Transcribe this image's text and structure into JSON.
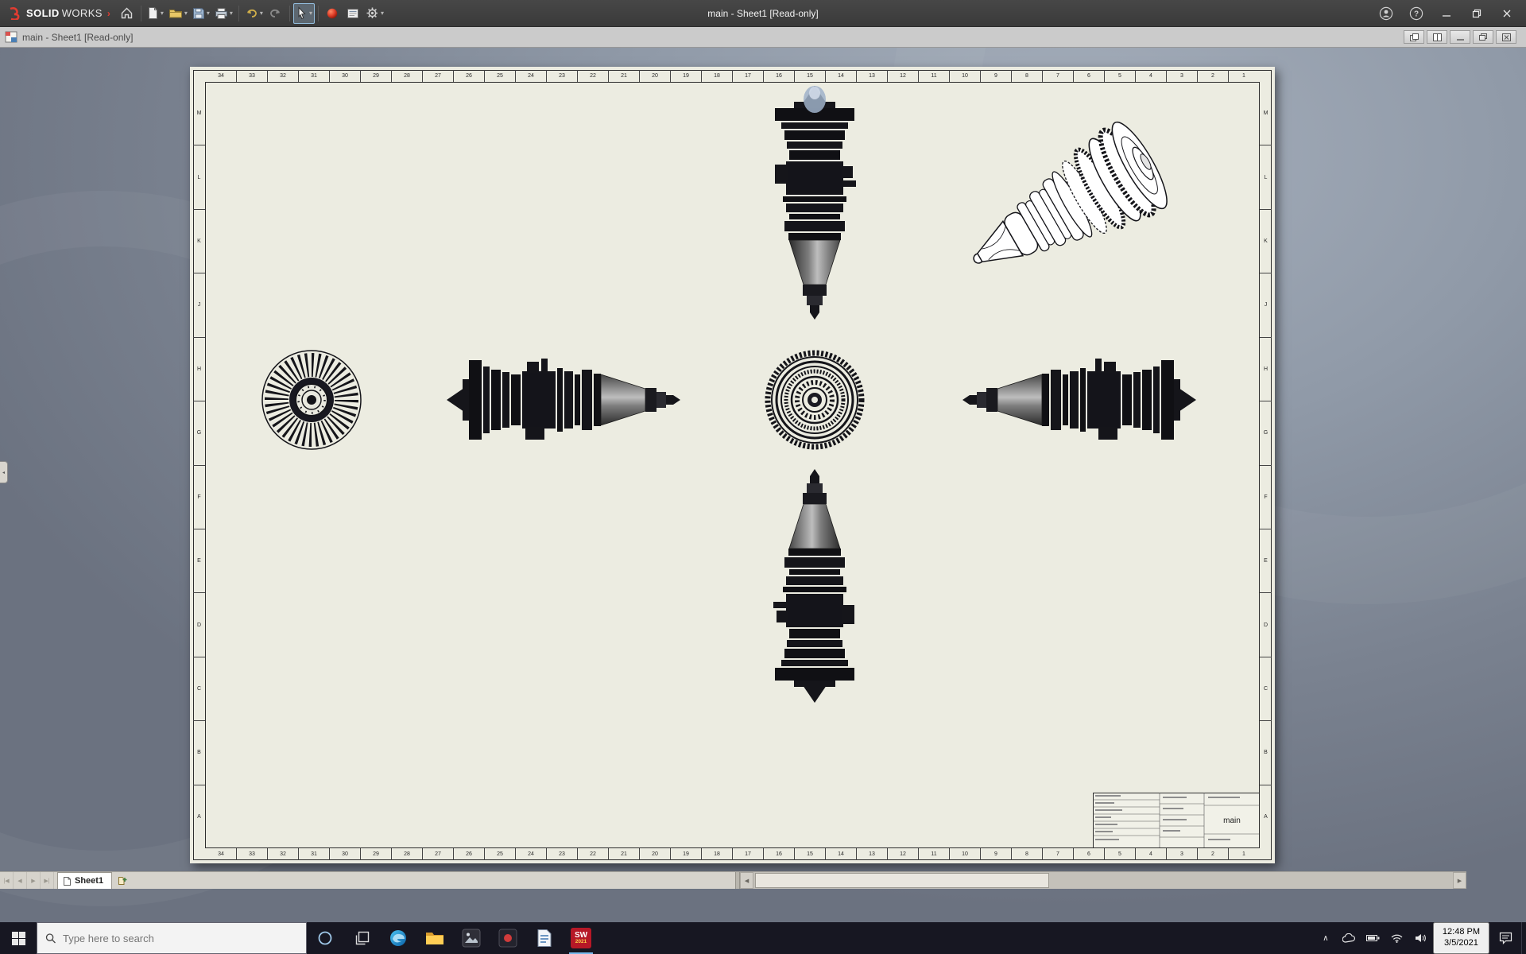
{
  "app": {
    "title": "main - Sheet1 [Read-only]"
  },
  "brand": {
    "prefix": "SOLID",
    "suffix": "WORKS",
    "flyout": "›"
  },
  "glyphs": {
    "caret_down": "▾",
    "help": "?",
    "tray_chevron": "∧",
    "flyout_collapse": "◂"
  },
  "sheet": {
    "tab_label": "Sheet1",
    "zone_numbers": [
      "34",
      "33",
      "32",
      "31",
      "30",
      "29",
      "28",
      "27",
      "26",
      "25",
      "24",
      "23",
      "22",
      "21",
      "20",
      "19",
      "18",
      "17",
      "16",
      "15",
      "14",
      "13",
      "12",
      "11",
      "10",
      "9",
      "8",
      "7",
      "6",
      "5",
      "4",
      "3",
      "2",
      "1"
    ],
    "zone_letters": [
      "M",
      "L",
      "K",
      "J",
      "H",
      "G",
      "F",
      "E",
      "D",
      "C",
      "B",
      "A"
    ],
    "title_block": {
      "name": "main"
    }
  },
  "tabbar": {
    "nav_first": "|◀",
    "nav_prev": "◀",
    "nav_next": "▶",
    "nav_last": "▶|",
    "scroll_left": "◀",
    "scroll_right": "▶"
  },
  "taskbar": {
    "search_placeholder": "Type here to search",
    "sw_label": "SW",
    "sw_badge": "2021",
    "clock": {
      "time": "12:48 PM",
      "date": "3/5/2021"
    }
  }
}
